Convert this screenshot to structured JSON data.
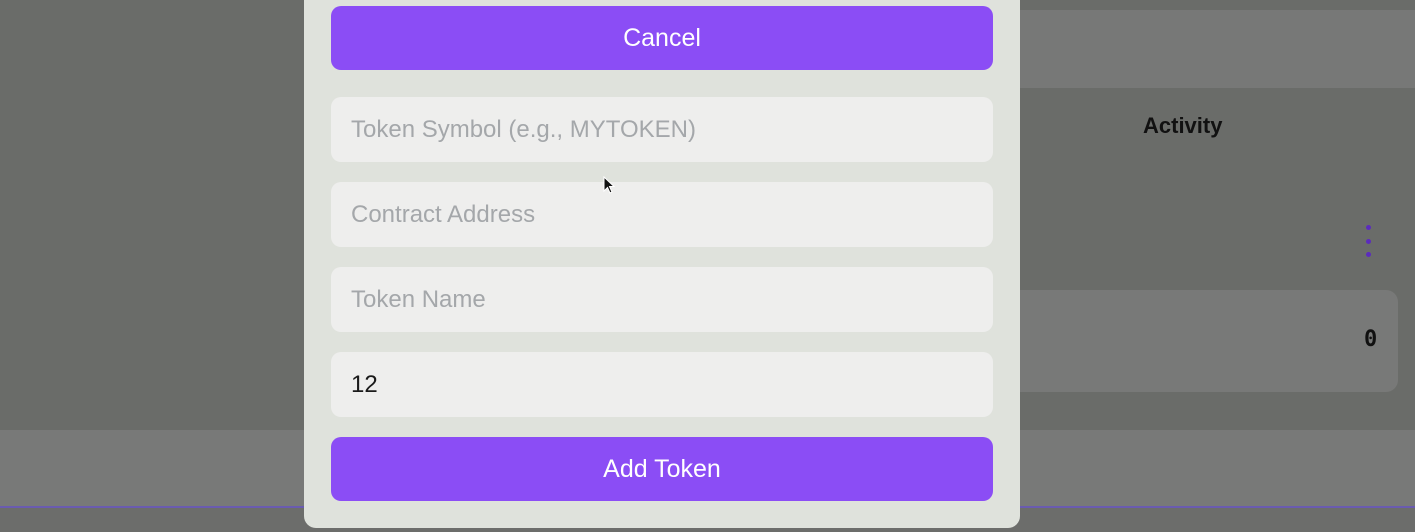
{
  "background": {
    "activity_label": "Activity",
    "count_value": "0"
  },
  "modal": {
    "cancel_label": "Cancel",
    "token_symbol": {
      "placeholder": "Token Symbol (e.g., MYTOKEN)",
      "value": ""
    },
    "contract_address": {
      "placeholder": "Contract Address",
      "value": ""
    },
    "token_name": {
      "placeholder": "Token Name",
      "value": ""
    },
    "decimals": {
      "placeholder": "",
      "value": "12"
    },
    "add_label": "Add Token"
  },
  "colors": {
    "accent": "#8b4df5",
    "modal_bg": "#dfe2dc",
    "field_bg": "#eeeeed",
    "overlay": "#6a6c69"
  },
  "icons": [
    "kebab-menu-icon",
    "mouse-cursor-icon"
  ]
}
